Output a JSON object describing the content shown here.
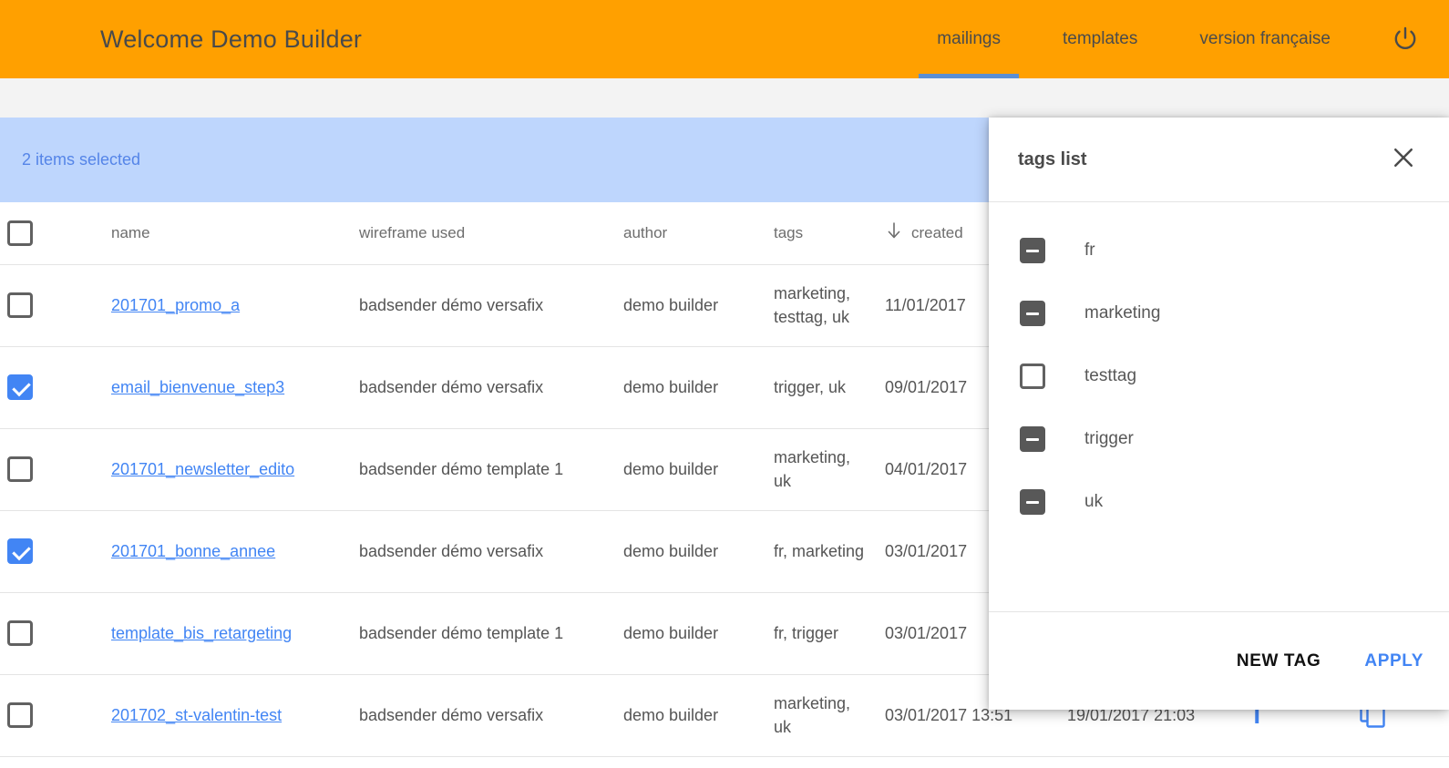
{
  "header": {
    "title": "Welcome Demo Builder",
    "nav": [
      {
        "label": "mailings",
        "active": true
      },
      {
        "label": "templates",
        "active": false
      },
      {
        "label": "version française",
        "active": false
      }
    ],
    "power_icon": "power-icon",
    "bg_color": "#ffa000",
    "active_indicator_color": "#5b8fd4"
  },
  "selection_banner": {
    "text": "2 items selected",
    "bg_color": "#bed6fd",
    "text_color": "#5585e8"
  },
  "table": {
    "columns": [
      {
        "key": "check",
        "label": ""
      },
      {
        "key": "name",
        "label": "name"
      },
      {
        "key": "wireframe",
        "label": "wireframe used"
      },
      {
        "key": "author",
        "label": "author"
      },
      {
        "key": "tags",
        "label": "tags"
      },
      {
        "key": "created",
        "label": "created",
        "sorted": true,
        "sort_dir": "desc"
      },
      {
        "key": "updated",
        "label": ""
      },
      {
        "key": "action1",
        "label": ""
      },
      {
        "key": "action2",
        "label": ""
      }
    ],
    "header_checkbox": "unchecked",
    "rows": [
      {
        "checked": false,
        "name": "201701_promo_a",
        "wireframe": "badsender démo versafix",
        "author": "demo builder",
        "tags": "marketing, testtag, uk",
        "created": "11/01/2017",
        "updated": "",
        "action1": "",
        "action2": ""
      },
      {
        "checked": true,
        "name": "email_bienvenue_step3",
        "wireframe": "badsender démo versafix",
        "author": "demo builder",
        "tags": "trigger, uk",
        "created": "09/01/2017",
        "updated": "",
        "action1": "",
        "action2": ""
      },
      {
        "checked": false,
        "name": "201701_newsletter_edito",
        "wireframe": "badsender démo template 1",
        "author": "demo builder",
        "tags": "marketing, uk",
        "created": "04/01/2017",
        "updated": "",
        "action1": "",
        "action2": ""
      },
      {
        "checked": true,
        "name": "201701_bonne_annee",
        "wireframe": "badsender démo versafix",
        "author": "demo builder",
        "tags": "fr, marketing",
        "created": "03/01/2017",
        "updated": "",
        "action1": "",
        "action2": ""
      },
      {
        "checked": false,
        "name": "template_bis_retargeting",
        "wireframe": "badsender démo template 1",
        "author": "demo builder",
        "tags": "fr, trigger",
        "created": "03/01/2017",
        "updated": "",
        "action1": "",
        "action2": ""
      },
      {
        "checked": false,
        "name": "201702_st-valentin-test",
        "wireframe": "badsender démo versafix",
        "author": "demo builder",
        "tags": "marketing, uk",
        "created": "03/01/2017 13:51",
        "updated": "19/01/2017 21:03",
        "action1": "T",
        "action2": "duplicate-icon"
      }
    ]
  },
  "tags_panel": {
    "title": "tags list",
    "close_icon": "close-icon",
    "tags": [
      {
        "label": "fr",
        "state": "indeterminate"
      },
      {
        "label": "marketing",
        "state": "indeterminate"
      },
      {
        "label": "testtag",
        "state": "unchecked"
      },
      {
        "label": "trigger",
        "state": "indeterminate"
      },
      {
        "label": "uk",
        "state": "indeterminate"
      }
    ],
    "new_tag_label": "NEW TAG",
    "apply_label": "APPLY",
    "apply_color": "#4285f4"
  }
}
